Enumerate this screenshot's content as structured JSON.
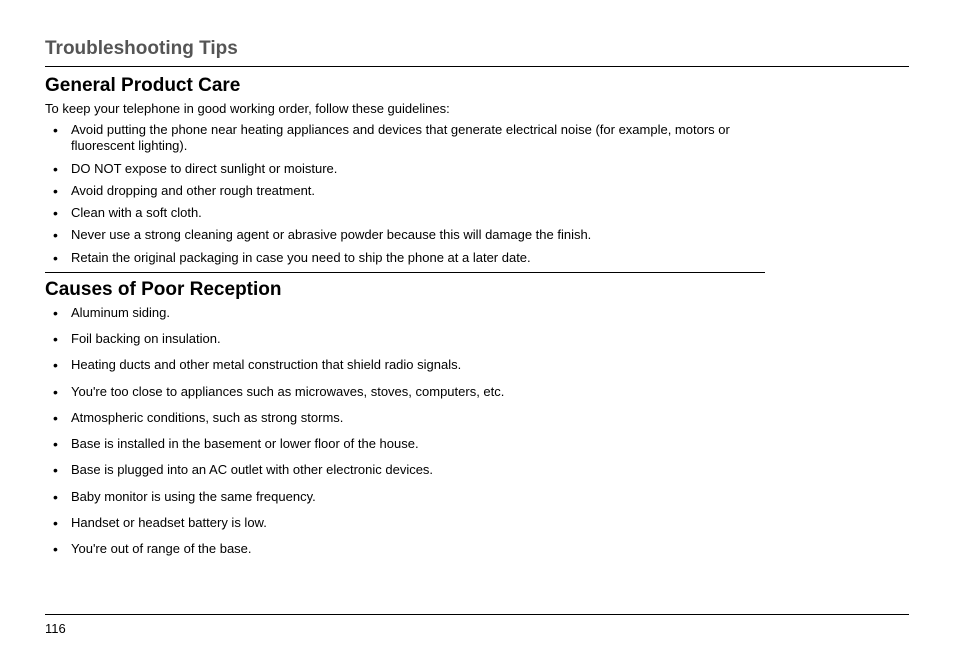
{
  "page_title": "Troubleshooting Tips",
  "section1": {
    "heading": "General Product Care",
    "intro": "To keep your telephone in good working order, follow these guidelines:",
    "items": [
      "Avoid putting the phone near heating appliances and devices that generate electrical noise (for example, motors or fluorescent lighting).",
      "DO NOT expose to direct sunlight or moisture.",
      "Avoid dropping and other rough treatment.",
      "Clean with a soft cloth.",
      "Never use a strong cleaning agent or abrasive powder because this will damage the finish.",
      "Retain the original packaging in case you need to ship the phone at a later date."
    ]
  },
  "section2": {
    "heading": "Causes of Poor Reception",
    "items": [
      "Aluminum siding.",
      "Foil backing on insulation.",
      "Heating ducts and other metal construction that shield radio signals.",
      "You're too close to appliances such as microwaves, stoves, computers, etc.",
      "Atmospheric conditions, such as strong storms.",
      "Base is installed in the basement or lower floor of the house.",
      "Base is plugged into an AC outlet with other electronic devices.",
      "Baby monitor is using the same frequency.",
      "Handset or headset battery is low.",
      "You're out of range of the base."
    ]
  },
  "page_number": "116"
}
